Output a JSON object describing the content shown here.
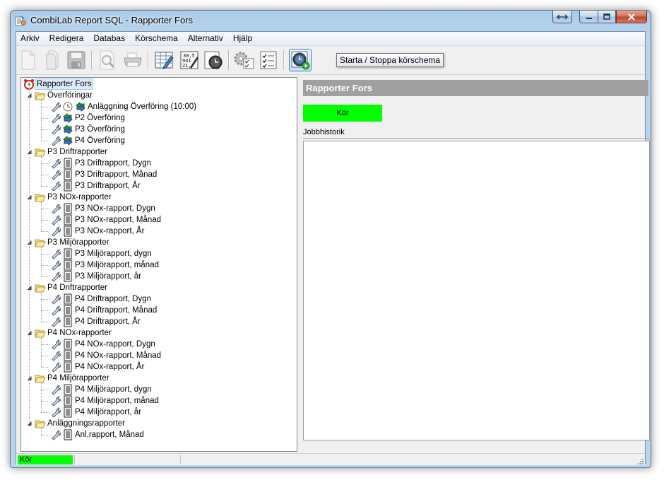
{
  "window": {
    "title": "CombiLab Report SQL - Rapporter Fors",
    "app_icon": "combilab-app-icon",
    "caption_buttons": {
      "restore": "restore-icon",
      "minimize": "minimize-icon",
      "maximize": "maximize-icon",
      "close": "close-icon"
    }
  },
  "menu": {
    "items": [
      "Arkiv",
      "Redigera",
      "Databas",
      "Körschema",
      "Alternativ",
      "Hjälp"
    ]
  },
  "toolbar": {
    "buttons": [
      {
        "icon": "new-document-icon"
      },
      {
        "icon": "copy-icon"
      },
      {
        "icon": "save-icon"
      },
      {
        "icon": "print-preview-icon"
      },
      {
        "icon": "print-icon"
      },
      {
        "icon": "table-edit-icon"
      },
      {
        "icon": "report-data-icon"
      },
      {
        "icon": "clock-schedule-icon"
      },
      {
        "icon": "settings-checklist-icon"
      },
      {
        "icon": "checklist-icon"
      },
      {
        "icon": "start-stop-schedule-icon"
      }
    ],
    "tooltip": "Starta / Stoppa körschema"
  },
  "tree": {
    "root": "Rapporter Fors",
    "groups": [
      {
        "label": "Överföringar",
        "items": [
          {
            "label": "Anläggning Överföring (10:00)",
            "kind": "transfer-timer"
          },
          {
            "label": "P2 Överföring",
            "kind": "transfer"
          },
          {
            "label": "P3 Överföring",
            "kind": "transfer"
          },
          {
            "label": "P4 Överföring",
            "kind": "transfer"
          }
        ]
      },
      {
        "label": "P3 Driftrapporter",
        "items": [
          {
            "label": "P3 Driftrapport, Dygn",
            "kind": "report"
          },
          {
            "label": "P3 Driftrapport, Månad",
            "kind": "report"
          },
          {
            "label": "P3 Driftrapport, År",
            "kind": "report"
          }
        ]
      },
      {
        "label": "P3 NOx-rapporter",
        "items": [
          {
            "label": "P3 NOx-rapport, Dygn",
            "kind": "report"
          },
          {
            "label": "P3 NOx-rapport, Månad",
            "kind": "report"
          },
          {
            "label": "P3 NOx-rapport, År",
            "kind": "report"
          }
        ]
      },
      {
        "label": "P3 Miljörapporter",
        "items": [
          {
            "label": "P3 Miljörapport, dygn",
            "kind": "report"
          },
          {
            "label": "P3 Miljörapport, månad",
            "kind": "report"
          },
          {
            "label": "P3 Miljörapport, år",
            "kind": "report"
          }
        ]
      },
      {
        "label": "P4 Driftrapporter",
        "items": [
          {
            "label": "P4 Driftrapport, Dygn",
            "kind": "report"
          },
          {
            "label": "P4 Driftrapport, Månad",
            "kind": "report"
          },
          {
            "label": "P4 Driftrapport, År",
            "kind": "report"
          }
        ]
      },
      {
        "label": "P4 NOx-rapporter",
        "items": [
          {
            "label": "P4 NOx-rapport, Dygn",
            "kind": "report"
          },
          {
            "label": "P4 NOx-rapport, Månad",
            "kind": "report"
          },
          {
            "label": "P4 NOx-rapport, År",
            "kind": "report"
          }
        ]
      },
      {
        "label": "P4 Miljörapporter",
        "items": [
          {
            "label": "P4 Miljörapport, dygn",
            "kind": "report"
          },
          {
            "label": "P4 Miljörapport, månad",
            "kind": "report"
          },
          {
            "label": "P4 Miljörapport, år",
            "kind": "report"
          }
        ]
      },
      {
        "label": "Anläggningsrapporter",
        "items": [
          {
            "label": "Anl.rapport, Månad",
            "kind": "report"
          }
        ]
      }
    ]
  },
  "panel": {
    "header": "Rapporter Fors",
    "run_button": "Kör",
    "history_label": "Jobbhistorik"
  },
  "status": {
    "pane1": "Kör"
  },
  "colors": {
    "run_green": "#00ff00",
    "panel_header_bg": "#a0a0a0"
  }
}
